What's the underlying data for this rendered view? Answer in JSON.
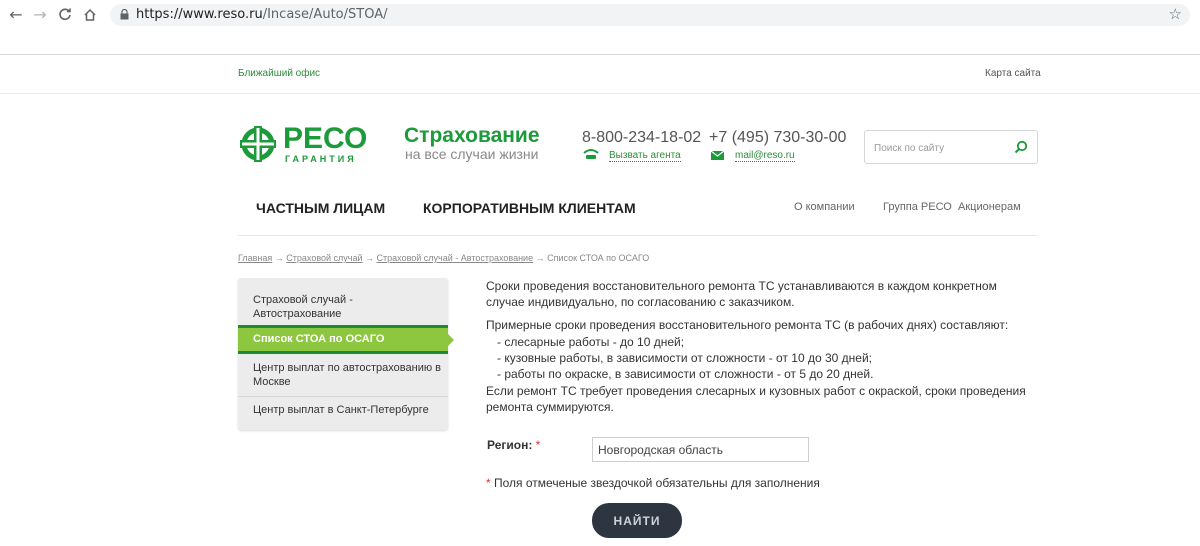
{
  "browser": {
    "url_host": "https://www.reso.ru",
    "url_path": "/Incase/Auto/STOA/",
    "back_icon": "arrow-left-icon",
    "forward_icon": "arrow-right-icon",
    "reload_icon": "reload-icon",
    "home_icon": "home-icon",
    "lock_icon": "lock-icon",
    "bookmark_icon": "star-icon"
  },
  "top_links": {
    "nearest_office": "Ближайший офис",
    "sitemap": "Карта сайта"
  },
  "header": {
    "logo_word": "РЕСО",
    "logo_sub": "ГАРАНТИЯ",
    "slogan_title": "Страхование",
    "slogan_sub": "на все случаи жизни",
    "phone_1": "8-800-234-18-02",
    "phone_2": "+7 (495) 730-30-00",
    "agent_link": "Вызвать агента",
    "mail_link": "mail@reso.ru",
    "search_placeholder": "Поиск по сайту"
  },
  "nav": {
    "main": [
      "ЧАСТНЫМ ЛИЦАМ",
      "КОРПОРАТИВНЫМ КЛИЕНТАМ"
    ],
    "secondary": [
      "О компании",
      "Группа РЕСО",
      "Акционерам"
    ]
  },
  "breadcrumb": {
    "items": [
      "Главная",
      "Страховой случай",
      "Страховой случай - Автострахование"
    ],
    "current": "Список СТОА по ОСАГО",
    "separator": " → "
  },
  "sidebar": {
    "items": [
      "Страховой случай - Автострахование",
      "Список СТОА по ОСАГО",
      "Центр выплат по автострахованию в Москве",
      "Центр выплат в Санкт-Петербурге"
    ],
    "active_index": 1
  },
  "content": {
    "para1": "Сроки проведения восстановительного ремонта ТС устанавливаются в каждом конкретном случае индивидуально, по согласованию с заказчиком.",
    "para2": "Примерные сроки проведения восстановительного ремонта ТС (в рабочих днях) составляют:",
    "list": [
      "- слесарные работы - до 10 дней;",
      "- кузовные работы, в зависимости от сложности - от 10 до 30 дней;",
      "- работы по окраске, в зависимости от сложности - от 5 до 20 дней."
    ],
    "para3": "Если ремонт ТС требует проведения слесарных и кузовных работ с окраской, сроки проведения ремонта суммируются."
  },
  "form": {
    "region_label": "Регион:",
    "required_mark": "*",
    "region_value": "Новгородская область",
    "required_note": "Поля отмеченые звездочкой обязательны для заполнения",
    "submit_label": "НАЙТИ"
  },
  "colors": {
    "brand_green": "#1d9a3a",
    "active_green": "#8dc63f",
    "button_dark": "#2d3541"
  }
}
